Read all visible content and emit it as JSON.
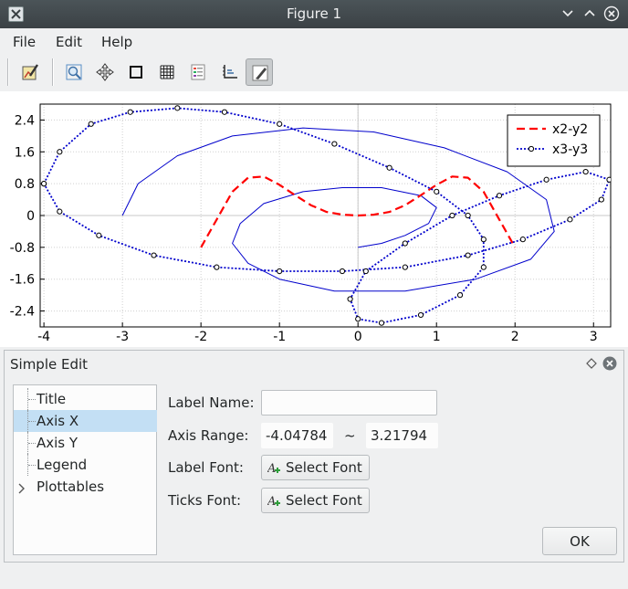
{
  "window": {
    "title": "Figure 1"
  },
  "menu": {
    "file": "File",
    "edit": "Edit",
    "help": "Help"
  },
  "toolbar": {
    "items": [
      {
        "icon": "edit-figure-icon"
      },
      {
        "icon": "zoom-icon"
      },
      {
        "icon": "pan-icon"
      },
      {
        "icon": "frame-icon"
      },
      {
        "icon": "grid-icon"
      },
      {
        "icon": "legend-icon"
      },
      {
        "icon": "axes-icon"
      },
      {
        "icon": "pen-icon",
        "active": true
      }
    ]
  },
  "chart_data": {
    "type": "line",
    "title": "",
    "xlabel": "",
    "ylabel": "",
    "xlim": [
      -4.04784,
      3.21794
    ],
    "ylim": [
      -2.8,
      2.8
    ],
    "x_ticks": [
      "-4",
      "-3",
      "-2",
      "-1",
      "0",
      "1",
      "2",
      "3"
    ],
    "y_ticks": [
      "2.4",
      "1.6",
      "0.8",
      "0",
      "-0.8",
      "-1.6",
      "-2.4"
    ],
    "grid": true,
    "legend": "top-right",
    "series": [
      {
        "name": "",
        "color": "#0000cc",
        "style": "solid",
        "x": [
          -3.0,
          -2.8,
          -2.3,
          -1.6,
          -0.7,
          0.2,
          1.1,
          1.9,
          2.4,
          2.5,
          2.2,
          1.5,
          0.6,
          -0.3,
          -1.0,
          -1.4,
          -1.6,
          -1.5,
          -1.2,
          -0.7,
          -0.2,
          0.3,
          0.8,
          1.0,
          0.9,
          0.6,
          0.3,
          0.0
        ],
        "y": [
          0.0,
          0.8,
          1.5,
          2.0,
          2.2,
          2.1,
          1.7,
          1.1,
          0.4,
          -0.4,
          -1.1,
          -1.6,
          -1.9,
          -1.9,
          -1.6,
          -1.2,
          -0.7,
          -0.2,
          0.3,
          0.6,
          0.7,
          0.7,
          0.5,
          0.2,
          -0.2,
          -0.5,
          -0.7,
          -0.8
        ]
      },
      {
        "name": "x2-y2",
        "color": "#ff0000",
        "style": "dashed",
        "x": [
          -2.0,
          -1.8,
          -1.6,
          -1.4,
          -1.2,
          -1.0,
          -0.8,
          -0.6,
          -0.4,
          -0.2,
          0.0,
          0.2,
          0.4,
          0.6,
          0.8,
          1.0,
          1.2,
          1.4,
          1.6,
          1.8,
          2.0
        ],
        "y": [
          -0.8,
          -0.1,
          0.6,
          0.95,
          0.98,
          0.77,
          0.51,
          0.26,
          0.09,
          0.02,
          0.0,
          0.02,
          0.09,
          0.26,
          0.51,
          0.77,
          0.98,
          0.95,
          0.6,
          -0.1,
          -0.8
        ]
      },
      {
        "name": "x3-y3",
        "color": "#0000cc",
        "style": "dotted",
        "marker": "circle",
        "x": [
          -4.0,
          -3.8,
          -3.4,
          -2.9,
          -2.3,
          -1.7,
          -1.0,
          -0.3,
          0.4,
          1.0,
          1.4,
          1.6,
          1.6,
          1.3,
          0.8,
          0.3,
          0.0,
          -0.1,
          0.1,
          0.6,
          1.2,
          1.8,
          2.4,
          2.9,
          3.2,
          3.1,
          2.7,
          2.1,
          1.4,
          0.6,
          -0.2,
          -1.0,
          -1.8,
          -2.6,
          -3.3,
          -3.8,
          -4.0
        ],
        "y": [
          0.8,
          1.6,
          2.3,
          2.6,
          2.7,
          2.6,
          2.3,
          1.8,
          1.2,
          0.6,
          0.0,
          -0.6,
          -1.3,
          -2.0,
          -2.5,
          -2.7,
          -2.6,
          -2.1,
          -1.4,
          -0.7,
          0.0,
          0.5,
          0.9,
          1.1,
          0.9,
          0.4,
          -0.1,
          -0.6,
          -1.0,
          -1.3,
          -1.4,
          -1.4,
          -1.3,
          -1.0,
          -0.5,
          0.1,
          0.8
        ]
      }
    ]
  },
  "dock": {
    "title": "Simple Edit"
  },
  "tree": {
    "items": [
      {
        "label": "Title",
        "selected": false,
        "expandable": false
      },
      {
        "label": "Axis X",
        "selected": true,
        "expandable": false
      },
      {
        "label": "Axis Y",
        "selected": false,
        "expandable": false
      },
      {
        "label": "Legend",
        "selected": false,
        "expandable": false
      },
      {
        "label": "Plottables",
        "selected": false,
        "expandable": true
      }
    ]
  },
  "form": {
    "label_name": "Label Name:",
    "label_name_value": "",
    "axis_range": "Axis Range:",
    "range_min": "-4.04784",
    "range_sep": "~",
    "range_max": "3.21794",
    "label_font": "Label Font:",
    "ticks_font": "Ticks Font:",
    "select_font": "Select Font",
    "ok": "OK"
  }
}
